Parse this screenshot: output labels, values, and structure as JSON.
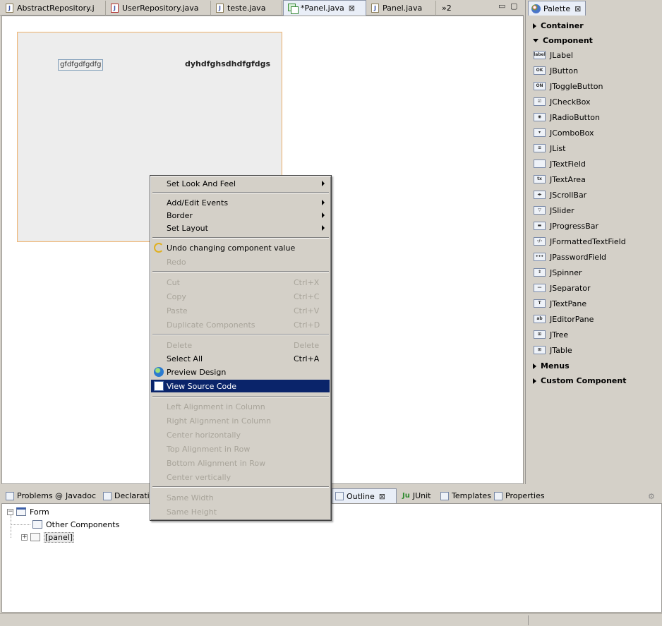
{
  "editor_tabs": [
    {
      "label": "AbstractRepository.j",
      "icon": "java-file-icon"
    },
    {
      "label": "UserRepository.java",
      "icon": "java-file-error-icon"
    },
    {
      "label": "teste.java",
      "icon": "java-file-icon"
    },
    {
      "label": "*Panel.java",
      "icon": "form-icon",
      "active": true
    },
    {
      "label": "Panel.java",
      "icon": "java-file-icon"
    }
  ],
  "overflow_tabs": "»2",
  "canvas": {
    "text_field_value": "gfdfgdfgdfg",
    "bold_label": "dyhdfghsdhdfgfdgs"
  },
  "palette": {
    "title": "Palette",
    "groups": {
      "container": "Container",
      "component": "Component",
      "menus": "Menus",
      "custom": "Custom Component"
    },
    "components": [
      {
        "label": "JLabel",
        "glyph": "label"
      },
      {
        "label": "JButton",
        "glyph": "OK"
      },
      {
        "label": "JToggleButton",
        "glyph": "ON"
      },
      {
        "label": "JCheckBox",
        "glyph": "☑"
      },
      {
        "label": "JRadioButton",
        "glyph": "◉"
      },
      {
        "label": "JComboBox",
        "glyph": "▾"
      },
      {
        "label": "JList",
        "glyph": "≡"
      },
      {
        "label": "JTextField",
        "glyph": ""
      },
      {
        "label": "JTextArea",
        "glyph": "tx"
      },
      {
        "label": "JScrollBar",
        "glyph": "◂▸"
      },
      {
        "label": "JSlider",
        "glyph": "▽"
      },
      {
        "label": "JProgressBar",
        "glyph": "▬"
      },
      {
        "label": "JFormattedTextField",
        "glyph": "-/-"
      },
      {
        "label": "JPasswordField",
        "glyph": "•••"
      },
      {
        "label": "JSpinner",
        "glyph": "⇕"
      },
      {
        "label": "JSeparator",
        "glyph": "—"
      },
      {
        "label": "JTextPane",
        "glyph": "T"
      },
      {
        "label": "JEditorPane",
        "glyph": "ab"
      },
      {
        "label": "JTree",
        "glyph": "⊞"
      },
      {
        "label": "JTable",
        "glyph": "⊞"
      }
    ]
  },
  "context_menu": {
    "set_look_and_feel": "Set Look And Feel",
    "add_edit_events": "Add/Edit Events",
    "border": "Border",
    "set_layout": "Set Layout",
    "undo": "Undo changing component value",
    "redo": "Redo",
    "cut": "Cut",
    "cut_sc": "Ctrl+X",
    "copy": "Copy",
    "copy_sc": "Ctrl+C",
    "paste": "Paste",
    "paste_sc": "Ctrl+V",
    "duplicate": "Duplicate Components",
    "duplicate_sc": "Ctrl+D",
    "delete": "Delete",
    "delete_sc": "Delete",
    "select_all": "Select All",
    "select_all_sc": "Ctrl+A",
    "preview": "Preview Design",
    "view_source": "View Source Code",
    "left_align": "Left Alignment in Column",
    "right_align": "Right Alignment in Column",
    "center_h": "Center horizontally",
    "top_align": "Top Alignment in Row",
    "bottom_align": "Bottom Alignment in Row",
    "center_v": "Center vertically",
    "same_width": "Same Width",
    "same_height": "Same Height"
  },
  "bottom_tabs": {
    "problems": "Problems",
    "javadoc": "Javadoc",
    "declaration": "Declaratio",
    "outline": "Outline",
    "junit": "JUnit",
    "templates": "Templates",
    "properties": "Properties"
  },
  "outline_tree": {
    "form": "Form",
    "other": "Other Components",
    "panel": "[panel]"
  }
}
